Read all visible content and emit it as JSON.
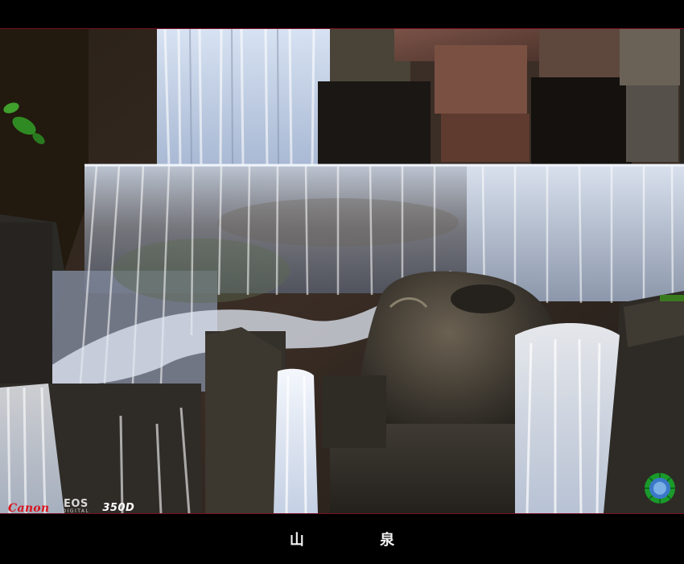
{
  "photo": {
    "caption": "山 泉"
  },
  "camera": {
    "brand_label": "Canon",
    "series_label": "EOS",
    "series_sub_label": "DIGITAL",
    "model_label": "350D"
  },
  "colors": {
    "frame_bg": "#000000",
    "frame_line": "#7a1020",
    "brand_red": "#d8141e",
    "water_white": "#eef3fb",
    "rock_dark": "#2e2b26",
    "stamp_green": "#1a9a2a"
  },
  "icons": {
    "stamp": "round-seal-icon"
  }
}
